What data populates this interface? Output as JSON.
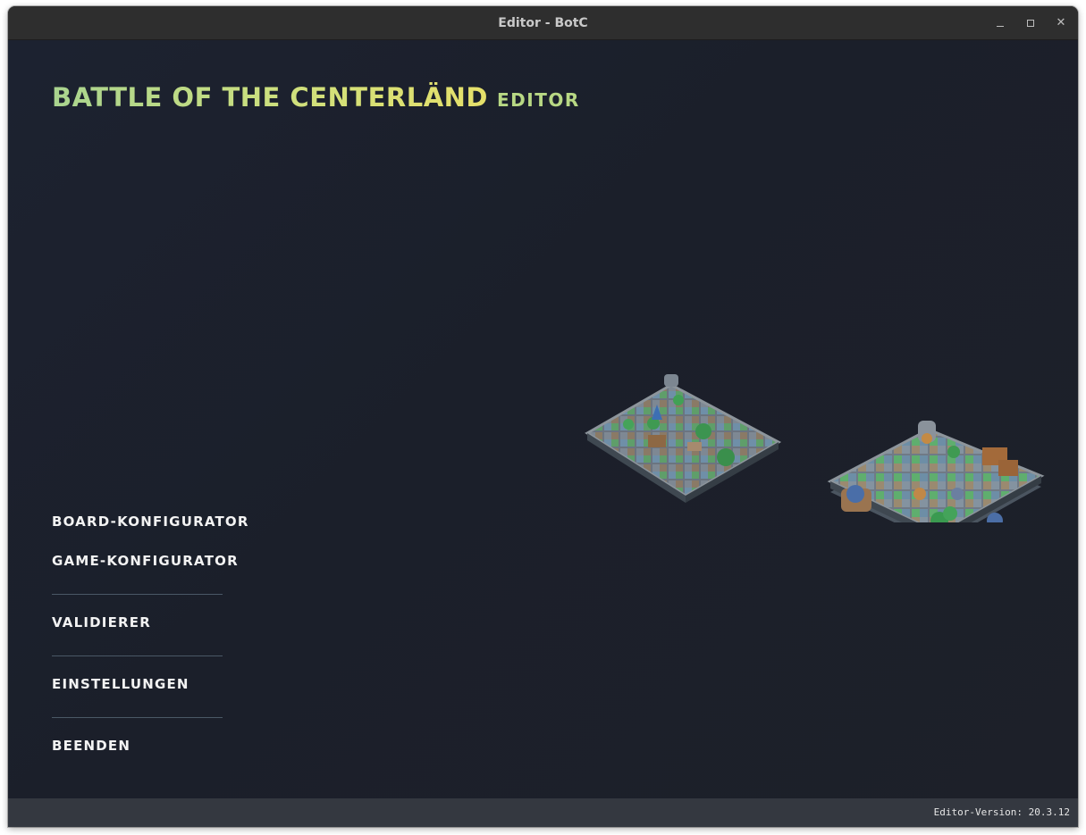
{
  "window": {
    "title": "Editor - BotC"
  },
  "logo": {
    "title": "Battle of the Centerländ",
    "subtitle": "Editor"
  },
  "menu": {
    "items": [
      {
        "label": "Board-Konfigurator"
      },
      {
        "label": "Game-Konfigurator"
      },
      {
        "label": "Validierer"
      },
      {
        "label": "Einstellungen"
      },
      {
        "label": "Beenden"
      }
    ]
  },
  "status": {
    "version": "Editor-Version: 20.3.12"
  },
  "icons": {
    "minimize": "minimize-icon",
    "maximize": "maximize-icon",
    "close": "close-icon"
  },
  "colors": {
    "background": "#1b1f2a",
    "logo_gradient_start": "#a9d48f",
    "logo_gradient_end": "#e6e06a",
    "menu_text": "#f3f3f3",
    "statusbar": "#343840"
  }
}
